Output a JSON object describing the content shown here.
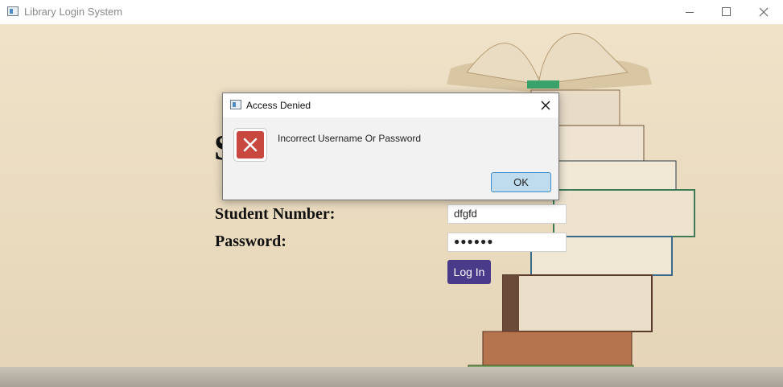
{
  "window": {
    "title": "Library Login System"
  },
  "page": {
    "heading_fragment": "S",
    "student_label": "Student Number:",
    "password_label": "Password:",
    "student_value": "dfgfd",
    "password_value": "●●●●●●",
    "login_label": "Log In"
  },
  "dialog": {
    "title": "Access Denied",
    "message": "Incorrect Username Or Password",
    "ok_label": "OK"
  },
  "colors": {
    "login_button": "#4a3a8a",
    "error_icon": "#c8473f",
    "ok_button": "#bfdcef",
    "ok_border": "#3b8fd1"
  }
}
